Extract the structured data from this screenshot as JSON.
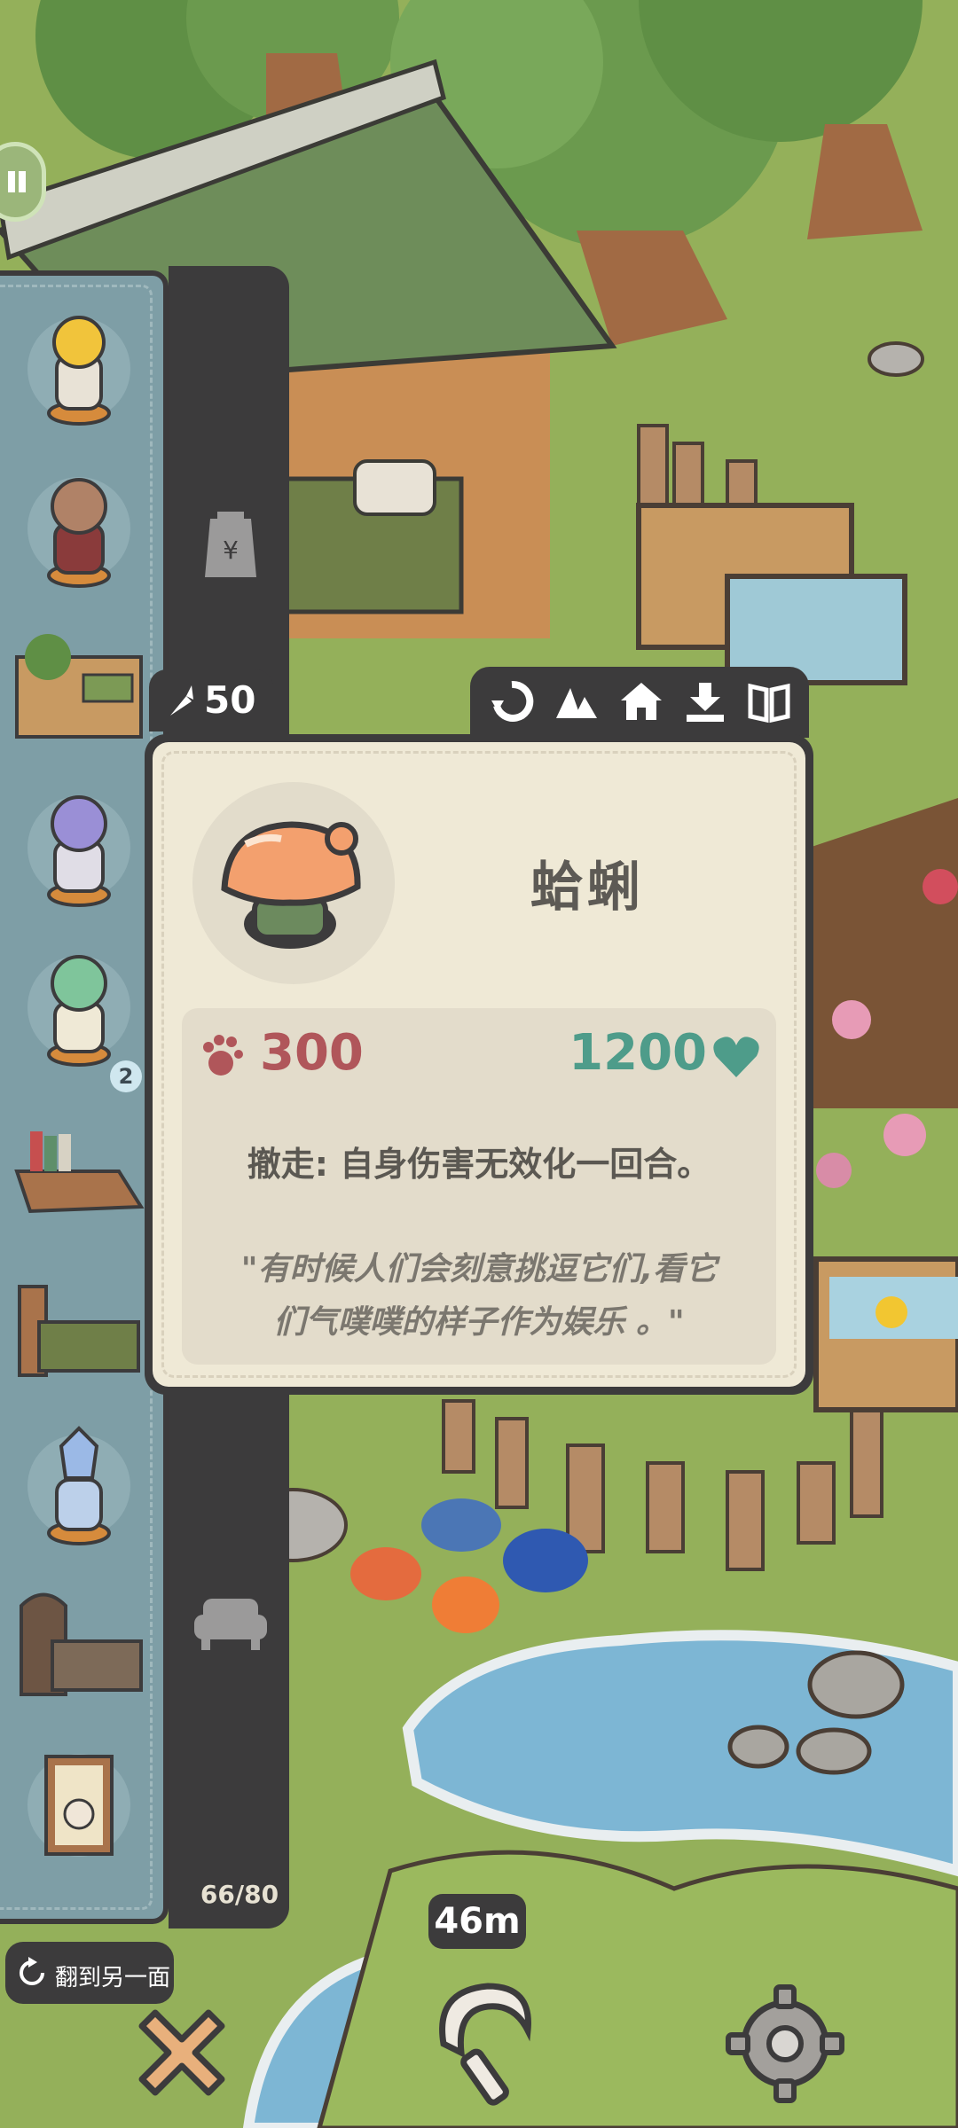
{
  "top_left_button": {
    "icon": "pause-icon"
  },
  "inventory": {
    "count_text": "66/80",
    "badge": "2",
    "items": [
      {
        "icon": "gold-mask-figure-icon"
      },
      {
        "icon": "bear-figure-icon"
      },
      {
        "icon": "plant-shelf-icon"
      },
      {
        "icon": "robot-figure-icon"
      },
      {
        "icon": "frog-figure-icon"
      },
      {
        "icon": "bookshelf-icon"
      },
      {
        "icon": "bed-icon"
      },
      {
        "icon": "crystal-figure-icon"
      },
      {
        "icon": "dark-bed-icon"
      },
      {
        "icon": "rabbit-painting-icon"
      }
    ]
  },
  "side_tabs": [
    {
      "icon": "seed-bag-icon"
    },
    {
      "icon": "sofa-icon"
    }
  ],
  "card": {
    "cost": "50",
    "cost_icon": "carrot-icon",
    "actions": [
      {
        "icon": "rotate-icon"
      },
      {
        "icon": "mountain-icon"
      },
      {
        "icon": "home-icon"
      },
      {
        "icon": "download-icon"
      },
      {
        "icon": "book-icon"
      }
    ],
    "name": "蛤蜊",
    "attack": "300",
    "health": "1200",
    "ability": "撤走: 自身伤害无效化一回合。",
    "flavor_line1": "\"有时候人们会刻意挑逗它们,看它",
    "flavor_line2": "们气噗噗的样子作为娱乐 。\""
  },
  "bottom": {
    "flip_label": "翻到另一面",
    "distance": "46m"
  },
  "colors": {
    "grass": "#94b05a",
    "panel_dark": "#3c3b3c",
    "inventory_bg": "#7e9ea6",
    "card_paper": "#efe9d6",
    "attack_red": "#b0565a",
    "health_teal": "#4e9c8a"
  }
}
